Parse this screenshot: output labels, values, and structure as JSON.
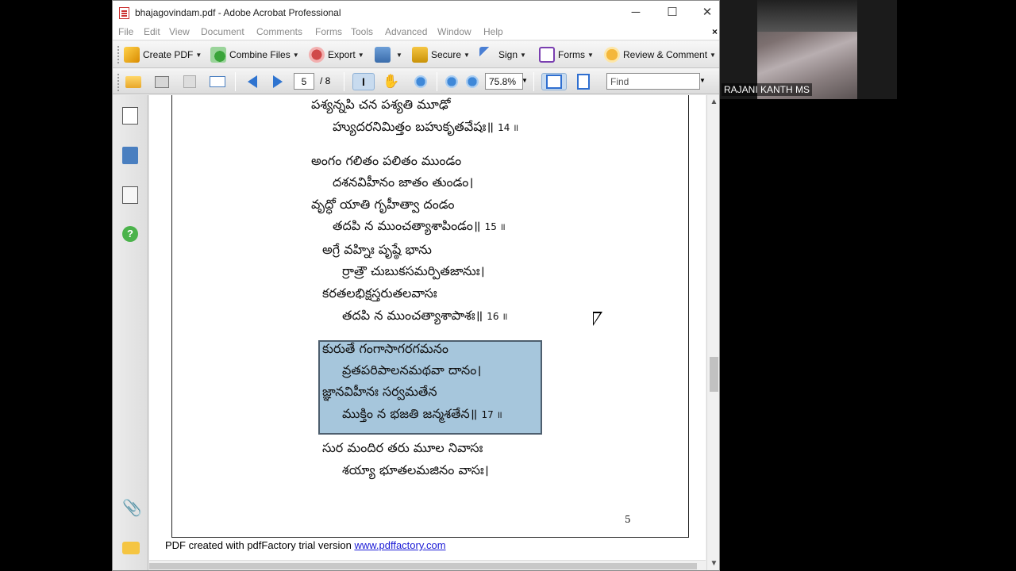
{
  "window": {
    "title": "bhajagovindam.pdf - Adobe Acrobat Professional",
    "controls": {
      "minimize": "─",
      "maximize": "☐",
      "close": "✕"
    }
  },
  "menu": {
    "items": [
      "File",
      "Edit",
      "View",
      "Document",
      "Comments",
      "Forms",
      "Tools",
      "Advanced",
      "Window",
      "Help"
    ],
    "close_doc": "×"
  },
  "task_toolbar": {
    "create_pdf": "Create PDF",
    "combine_files": "Combine Files",
    "export": "Export",
    "secure": "Secure",
    "sign": "Sign",
    "forms": "Forms",
    "review_comment": "Review & Comment"
  },
  "nav_toolbar": {
    "current_page": "5",
    "total_pages": "/ 8",
    "zoom": "75.8%",
    "find_placeholder": "Find"
  },
  "document": {
    "lines": [
      "పశ్యన్నపి చన పశ్యతి మూఢో",
      "హ్యుదరనిమిత్తం బహుకృతవేషః॥",
      "అంగం గలితం పలితం ముండం",
      "దశనవిహీనం జాతం తుండం।",
      "వృద్ధో యాతి గృహీత్వా దండం",
      "తదపి న ముంచత్యాశాపిండం॥",
      "అగ్రే వహ్నిః పృష్ఠే భాను",
      "ర్రాత్రౌ చుబుకసమర్పితజానుః।",
      "కరతలభిక్షస్తరుతలవాసః",
      "తదపి న ముంచత్యాశాపాశః॥",
      "కురుతే గంగాసాగరగమనం",
      "వ్రతపరిపాలనమథవా దానం।",
      "జ్ఞానవిహీనః సర్వమతేన",
      "ముక్తిం న భజతి జన్మశతేన॥",
      "సుర మందిర తరు మూల నివాసః",
      "శయ్యా భూతలమజినం వాసః।"
    ],
    "verse_numbers": {
      "v14": "14 ॥",
      "v15": "15 ॥",
      "v16": "16 ॥",
      "v17": "17 ॥"
    },
    "page_number": "5",
    "footer_text": "PDF created with pdfFactory trial version",
    "footer_link": "www.pdffactory.com"
  },
  "webcam": {
    "participant_name": "RAJANI KANTH MS"
  },
  "colors": {
    "highlight_box": "#a6c6dc",
    "link": "#1a1ad6"
  }
}
